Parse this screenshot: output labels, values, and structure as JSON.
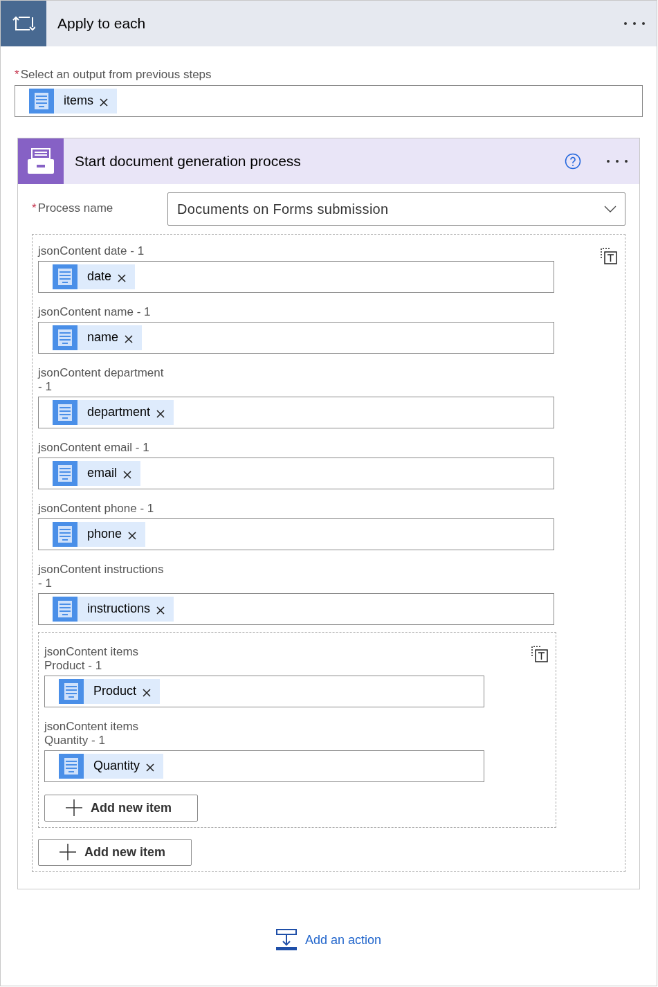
{
  "loop": {
    "title": "Apply to each",
    "output_label": "Select an output from previous steps",
    "required_marker": "*",
    "tokens": [
      {
        "label": "items"
      }
    ]
  },
  "action": {
    "title": "Start document generation process",
    "process_label": "Process name",
    "process_required_marker": "*",
    "process_value": "Documents on Forms submission",
    "fields": [
      {
        "label": "jsonContent date - 1",
        "token": "date"
      },
      {
        "label": "jsonContent name - 1",
        "token": "name"
      },
      {
        "label": "jsonContent department - 1",
        "token": "department"
      },
      {
        "label": "jsonContent email - 1",
        "token": "email"
      },
      {
        "label": "jsonContent phone - 1",
        "token": "phone"
      },
      {
        "label": "jsonContent instructions - 1",
        "token": "instructions"
      }
    ],
    "items_group": {
      "fields": [
        {
          "label": "jsonContent items Product - 1",
          "token": "Product"
        },
        {
          "label": "jsonContent items Quantity - 1",
          "token": "Quantity"
        }
      ],
      "add_button": "Add new item"
    },
    "add_button": "Add new item"
  },
  "add_action": "Add an action"
}
